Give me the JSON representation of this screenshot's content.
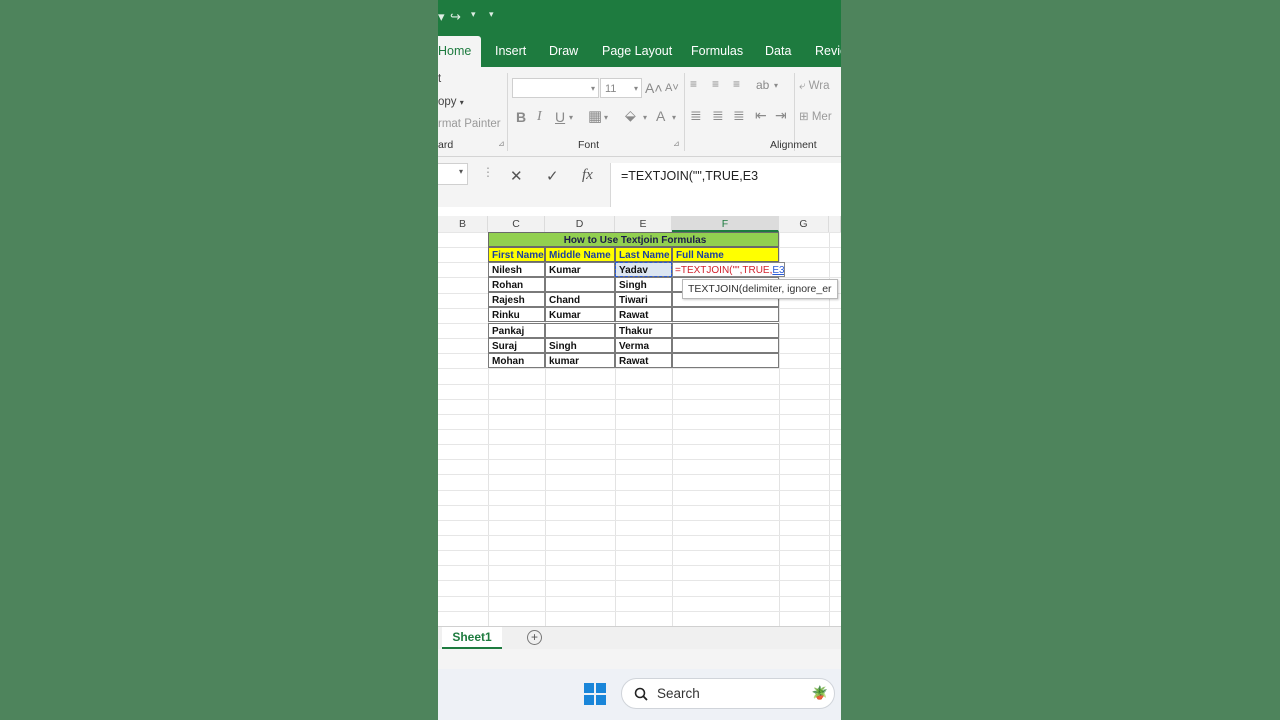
{
  "colors": {
    "excel_green": "#1e7b3f",
    "title_band": "#92d050",
    "header_band": "#ffff00",
    "background": "#4e845c",
    "formula_red": "#d2222d",
    "formula_blue": "#2a5bd7"
  },
  "ribbon": {
    "tabs": [
      "Home",
      "Insert",
      "Draw",
      "Page Layout",
      "Formulas",
      "Data",
      "Revie"
    ],
    "clipboard": {
      "cut": "t",
      "copy": "opy",
      "format_painter": "rmat Painter",
      "group_label": "ard"
    },
    "font": {
      "name": "",
      "size": "11",
      "group_label": "Font",
      "bold": "B",
      "italic": "I",
      "underline": "U"
    },
    "alignment": {
      "wrap": "Wra",
      "merge": "Mer",
      "group_label": "Alignment"
    }
  },
  "formula_bar": {
    "cancel_icon": "close-icon",
    "enter_icon": "check-icon",
    "fx": "fx",
    "value": "=TEXTJOIN(\"\",TRUE,E3"
  },
  "grid": {
    "columns": [
      "B",
      "C",
      "D",
      "E",
      "F",
      "G"
    ],
    "selected_column": "F",
    "title": "How to Use Textjoin Formulas",
    "headers": [
      "First Name",
      "Middle Name",
      "Last Name",
      "Full Name"
    ],
    "rows": [
      [
        "Nilesh",
        "Kumar",
        "Yadav"
      ],
      [
        "Rohan",
        "",
        "Singh"
      ],
      [
        "Rajesh",
        "Chand",
        "Tiwari"
      ],
      [
        "Rinku",
        "Kumar",
        "Rawat"
      ],
      [
        "Pankaj",
        "",
        "Thakur"
      ],
      [
        "Suraj",
        "Singh",
        "Verma"
      ],
      [
        "Mohan",
        "kumar",
        "Rawat"
      ]
    ],
    "editing_formula": {
      "func": "=TEXTJOIN(\"\",TRUE,",
      "ref": "E3"
    },
    "tooltip": "TEXTJOIN(delimiter, ignore_er"
  },
  "sheets": {
    "active": "Sheet1"
  },
  "taskbar": {
    "search_label": "Search"
  }
}
